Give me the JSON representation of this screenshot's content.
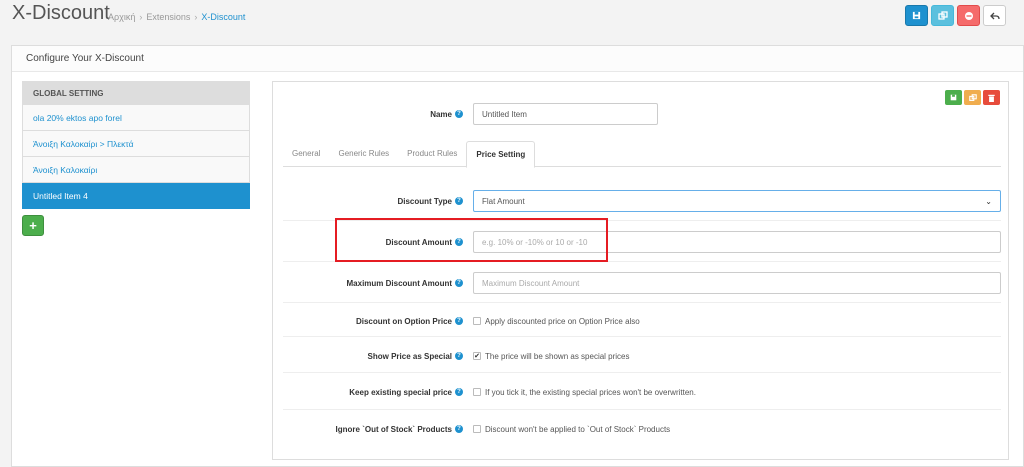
{
  "header": {
    "title": "X-Discount",
    "breadcrumbs": [
      "Αρχική",
      "Extensions",
      "X-Discount"
    ],
    "buttons": [
      {
        "name": "save-top-button",
        "icon": "floppy-icon",
        "color": "#1e91cf"
      },
      {
        "name": "copy-top-button",
        "icon": "copy-icon",
        "color": "#5bc0de"
      },
      {
        "name": "delete-top-button",
        "icon": "minus-circle-icon",
        "color": "#f56b6b"
      },
      {
        "name": "back-button",
        "icon": "reply-icon",
        "color": "#ffffff"
      }
    ]
  },
  "panel": {
    "heading": "Configure Your X-Discount"
  },
  "sidebar": {
    "items": [
      {
        "label": "GLOBAL SETTING"
      },
      {
        "label": "ola 20% ektos apo forel"
      },
      {
        "label": "Άνοιξη Καλοκαίρι > Πλεκτά"
      },
      {
        "label": "Άνοιξη Καλοκαίρι"
      },
      {
        "label": "Untitled Item 4"
      }
    ],
    "add_icon": "plus-icon"
  },
  "form": {
    "name_label": "Name",
    "name_value": "Untitled Item",
    "tabs": [
      {
        "label": "General"
      },
      {
        "label": "Generic Rules"
      },
      {
        "label": "Product Rules"
      },
      {
        "label": "Price Setting"
      }
    ],
    "active_tab": "Price Setting",
    "discount_type_label": "Discount Type",
    "discount_type_value": "Flat Amount",
    "discount_amount_label": "Discount Amount",
    "discount_amount_placeholder": "e.g. 10% or -10% or 10 or -10",
    "max_discount_label": "Maximum Discount Amount",
    "max_discount_placeholder": "Maximum Discount Amount",
    "option_price_label": "Discount on Option Price",
    "option_price_text": "Apply discounted price on Option Price also",
    "option_price_checked": false,
    "show_special_label": "Show Price as Special",
    "show_special_text": "The price will be shown as special prices",
    "show_special_checked": true,
    "keep_special_label": "Keep existing special price",
    "keep_special_text": "If you tick it, the existing special prices won't be overwritten.",
    "keep_special_checked": false,
    "ignore_oos_label": "Ignore `Out of Stock` Products",
    "ignore_oos_text": "Discount won't be applied to `Out of Stock` Products",
    "ignore_oos_checked": false
  },
  "colors": {
    "primary": "#1e91cf",
    "success": "#4cae4c",
    "warning": "#f0ad4e",
    "danger": "#e74c3c",
    "highlight": "#e51c23"
  }
}
